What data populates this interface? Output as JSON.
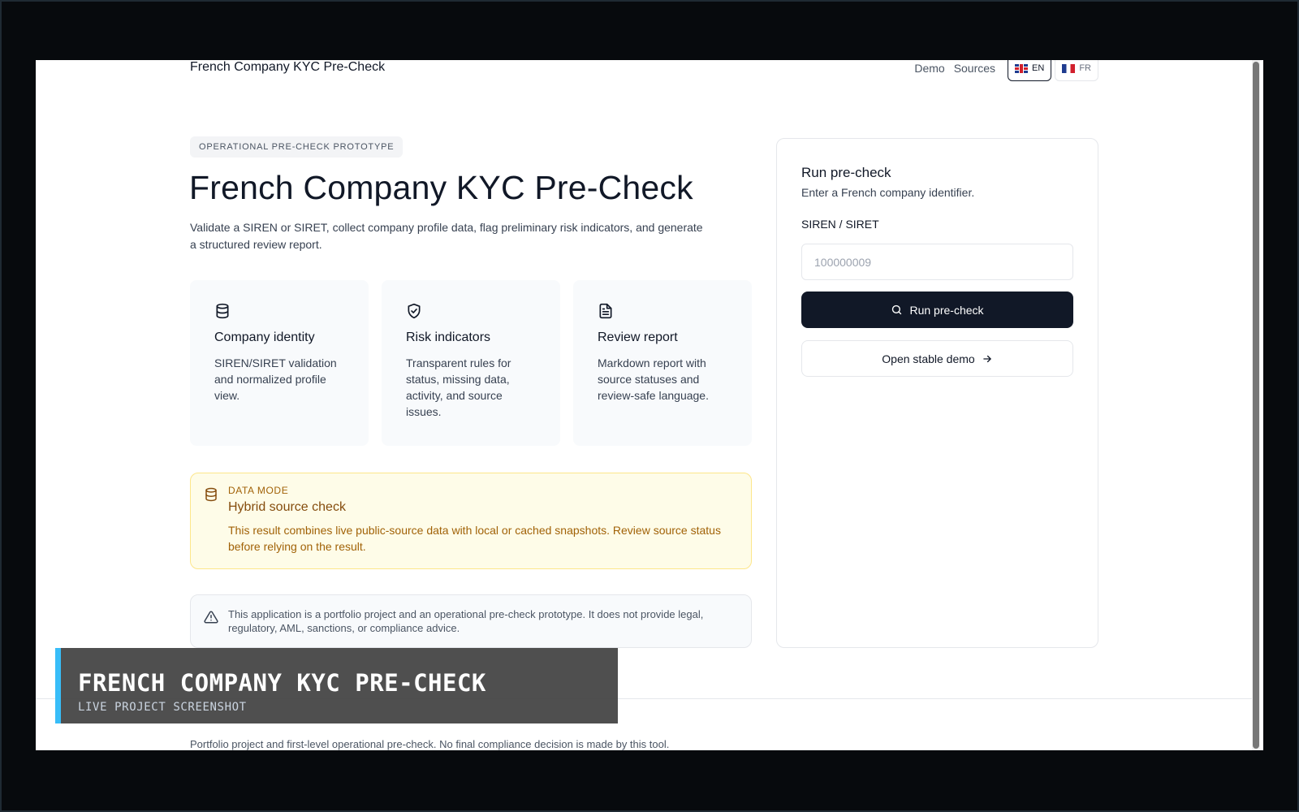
{
  "header": {
    "site_title": "French Company KYC Pre-Check",
    "nav": {
      "demo": "Demo",
      "sources": "Sources"
    },
    "languages": [
      {
        "code": "EN",
        "flag": "uk-flag",
        "active": true
      },
      {
        "code": "FR",
        "flag": "fr-flag",
        "active": false
      }
    ]
  },
  "hero": {
    "badge": "OPERATIONAL PRE-CHECK PROTOTYPE",
    "title": "French Company KYC Pre-Check",
    "description": "Validate a SIREN or SIRET, collect company profile data, flag preliminary risk indicators, and generate a structured review report."
  },
  "features": [
    {
      "icon": "database-icon",
      "title": "Company identity",
      "text": "SIREN/SIRET validation and normalized profile view."
    },
    {
      "icon": "shield-check-icon",
      "title": "Risk indicators",
      "text": "Transparent rules for status, missing data, activity, and source issues."
    },
    {
      "icon": "document-icon",
      "title": "Review report",
      "text": "Markdown report with source statuses and review-safe language."
    }
  ],
  "data_mode": {
    "icon": "database-icon",
    "label": "DATA MODE",
    "title": "Hybrid source check",
    "text": "This result combines live public-source data with local or cached snapshots. Review source status before relying on the result."
  },
  "disclaimer": {
    "icon": "warning-triangle-icon",
    "text": "This application is a portfolio project and an operational pre-check prototype. It does not provide legal, regulatory, AML, sanctions, or compliance advice."
  },
  "form": {
    "title": "Run pre-check",
    "subtitle": "Enter a French company identifier.",
    "field_label": "SIREN / SIRET",
    "input_placeholder": "100000009",
    "input_value": "",
    "run_button": "Run pre-check",
    "demo_button": "Open stable demo"
  },
  "footer": {
    "text": "Portfolio project and first-level operational pre-check. No final compliance decision is made by this tool."
  },
  "caption": {
    "title": "FRENCH COMPANY KYC PRE-CHECK",
    "subtitle": "LIVE PROJECT SCREENSHOT"
  },
  "colors": {
    "primary": "#111827",
    "notice_bg": "#fefce8",
    "notice_border": "#fde68a",
    "notice_text": "#a16207",
    "caption_accent": "#38bdf8"
  }
}
